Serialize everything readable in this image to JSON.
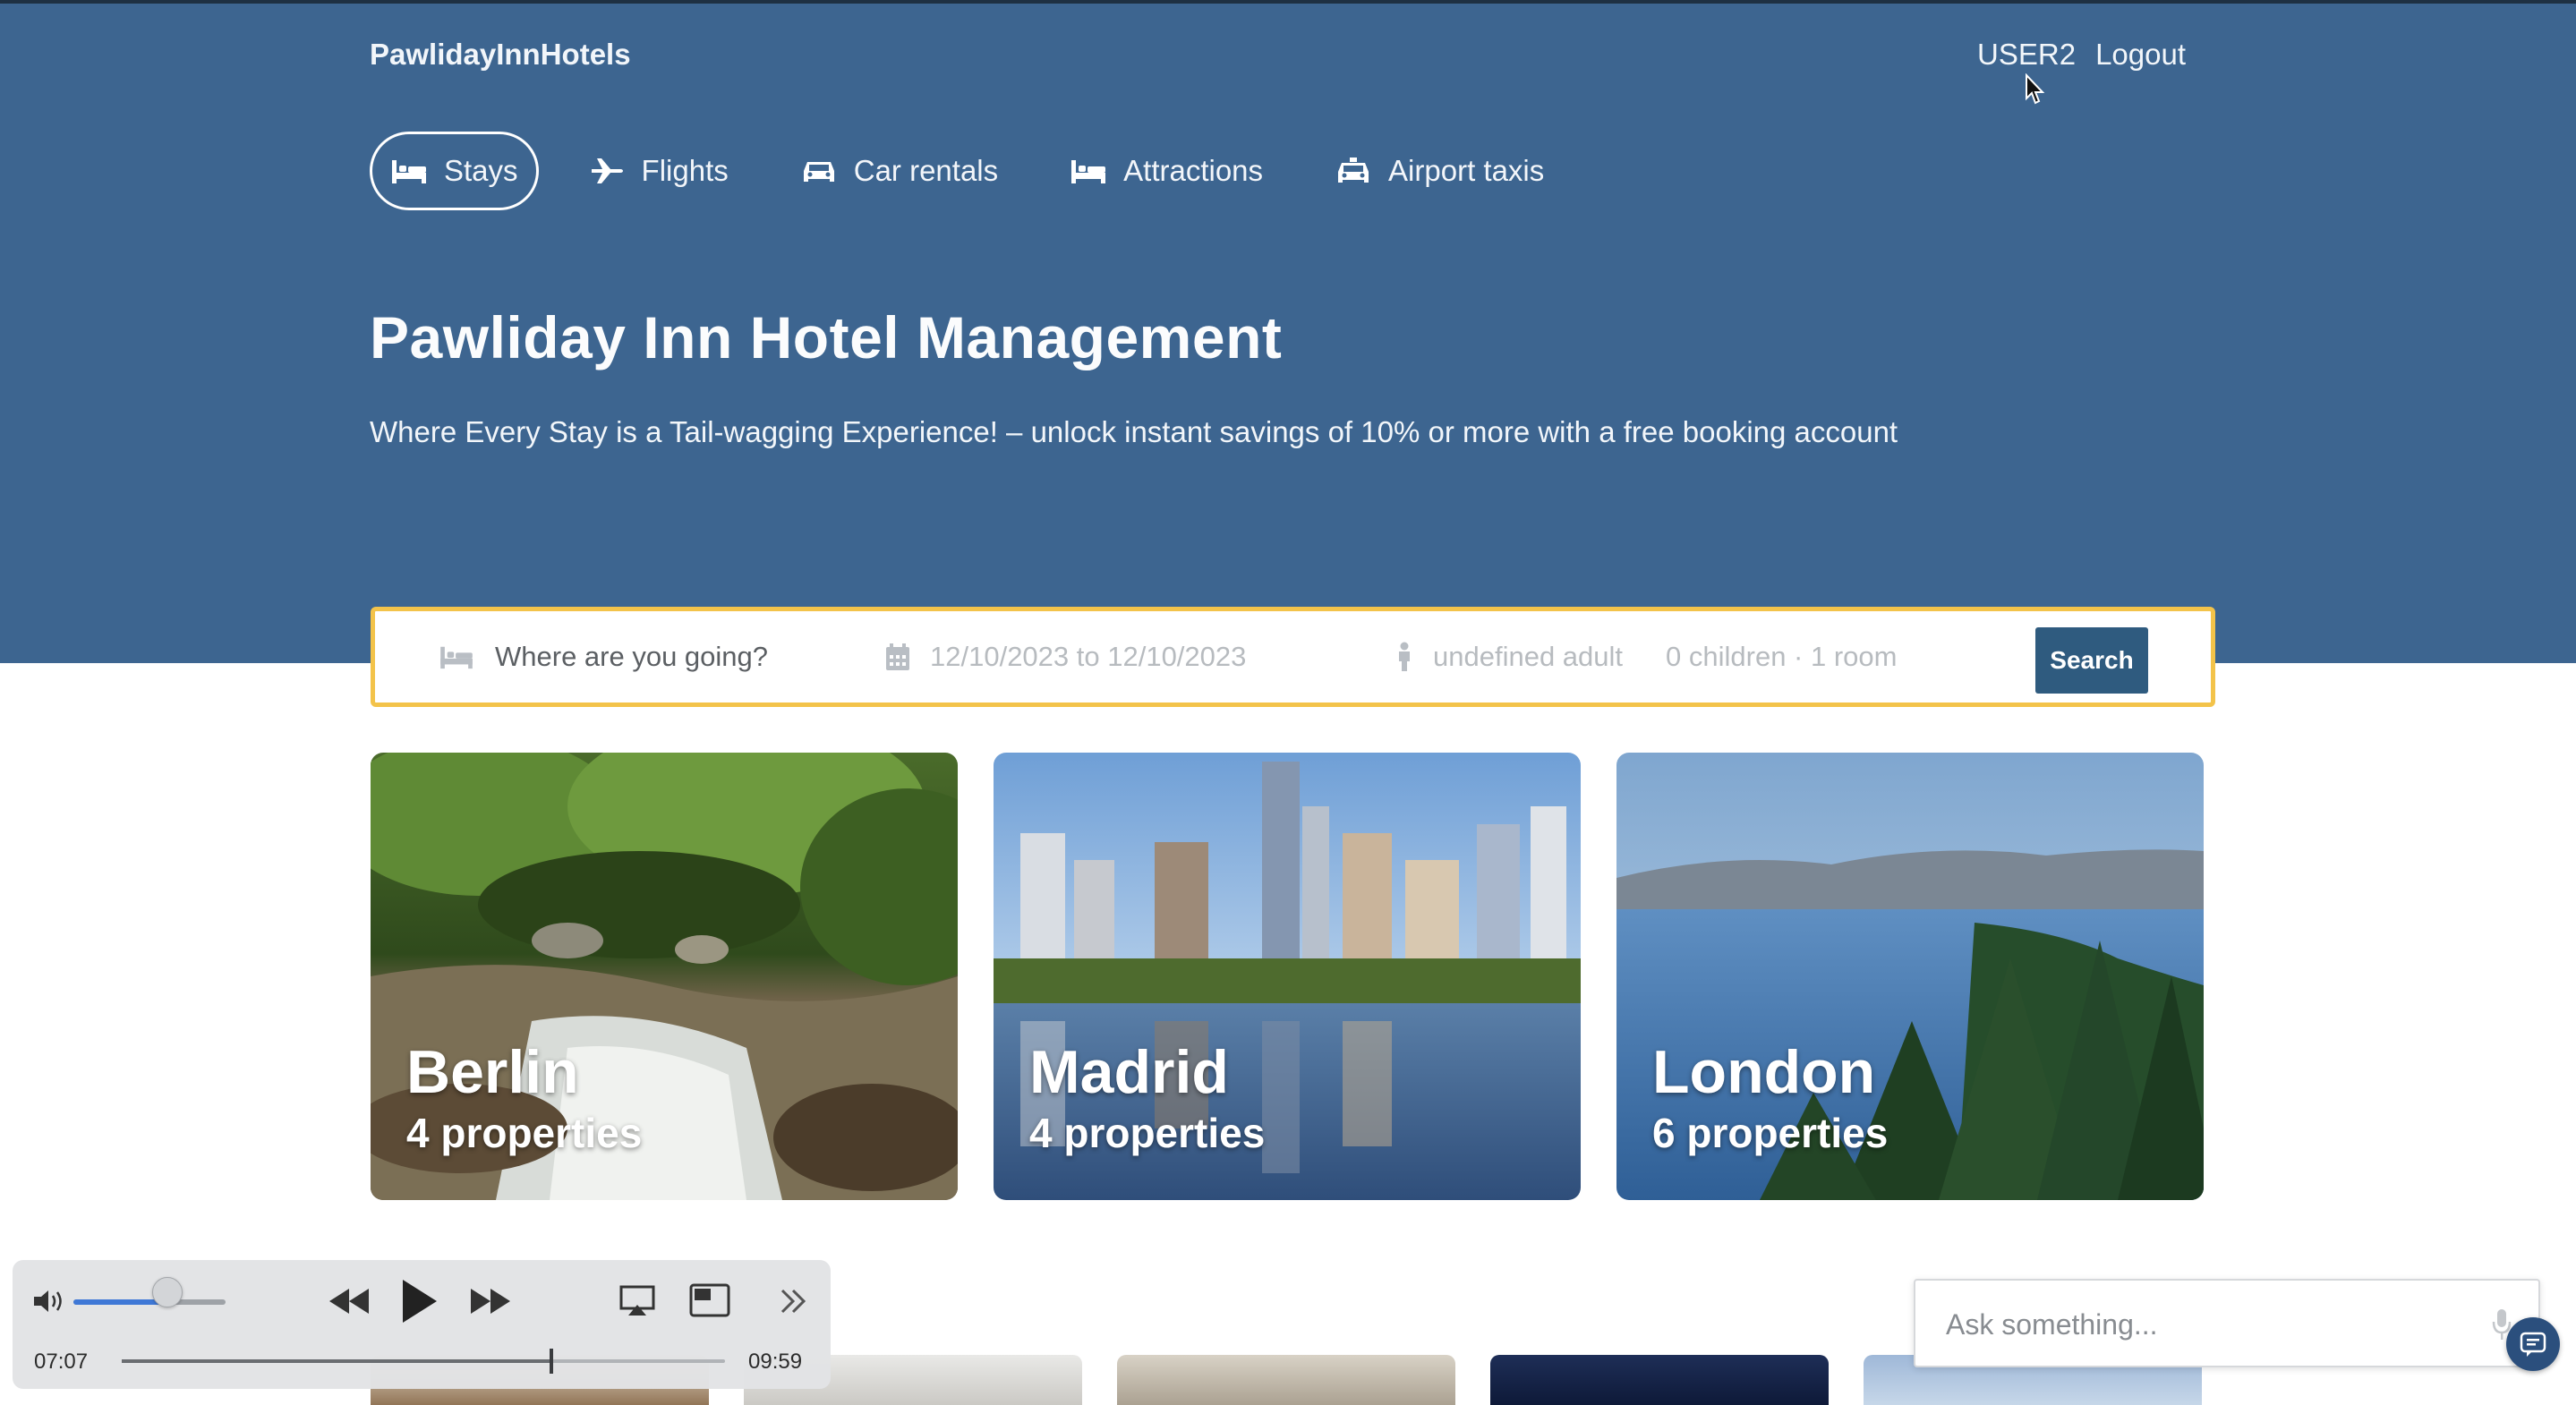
{
  "header": {
    "brand": "PawlidayInnHotels",
    "username": "USER2",
    "logout_label": "Logout"
  },
  "nav": {
    "items": [
      {
        "label": "Stays",
        "icon": "bed-icon",
        "active": true
      },
      {
        "label": "Flights",
        "icon": "plane-icon",
        "active": false
      },
      {
        "label": "Car rentals",
        "icon": "car-icon",
        "active": false
      },
      {
        "label": "Attractions",
        "icon": "bed-icon",
        "active": false
      },
      {
        "label": "Airport taxis",
        "icon": "taxi-icon",
        "active": false
      }
    ]
  },
  "hero": {
    "title": "Pawliday Inn Hotel Management",
    "subtitle": "Where Every Stay is a Tail-wagging Experience! – unlock instant savings of 10% or more with a free booking account"
  },
  "search": {
    "destination_placeholder": "Where are you going?",
    "dates": "12/10/2023 to 12/10/2023",
    "adults": "undefined adult",
    "children_rooms": "0 children · 1 room",
    "button_label": "Search"
  },
  "cities": [
    {
      "name": "Berlin",
      "properties": "4 properties"
    },
    {
      "name": "Madrid",
      "properties": "4 properties"
    },
    {
      "name": "London",
      "properties": "6 properties"
    }
  ],
  "player": {
    "current_time": "07:07",
    "duration": "09:59",
    "progress": 0.712,
    "volume": 0.62
  },
  "chat": {
    "placeholder": "Ask something..."
  },
  "colors": {
    "hero_bg": "#3d6590",
    "search_border": "#f3c34a",
    "search_button": "#2f5b7f"
  }
}
